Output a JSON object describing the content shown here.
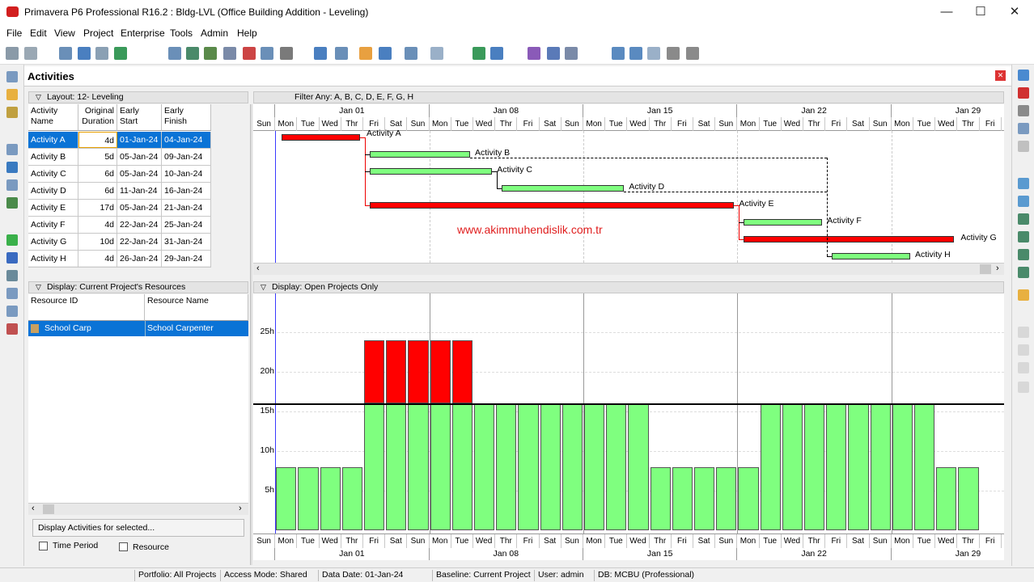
{
  "window": {
    "title": "Primavera P6 Professional R16.2 : Bldg-LVL (Office Building Addition - Leveling)",
    "min": "—",
    "max": "☐",
    "close": "✕"
  },
  "menu": [
    "File",
    "Edit",
    "View",
    "Project",
    "Enterprise",
    "Tools",
    "Admin",
    "Help"
  ],
  "panel": {
    "title": "Activities"
  },
  "layout_label": "Layout: 12- Leveling",
  "filter_label": "Filter Any: A, B, C, D, E, F, G, H",
  "columns": {
    "name": "Activity Name",
    "dur": "Original Duration",
    "start": "Early Start",
    "finish": "Early Finish"
  },
  "activities": [
    {
      "name": "Activity A",
      "dur": "4d",
      "start": "01-Jan-24",
      "finish": "04-Jan-24",
      "crit": true
    },
    {
      "name": "Activity B",
      "dur": "5d",
      "start": "05-Jan-24",
      "finish": "09-Jan-24",
      "crit": false
    },
    {
      "name": "Activity C",
      "dur": "6d",
      "start": "05-Jan-24",
      "finish": "10-Jan-24",
      "crit": false
    },
    {
      "name": "Activity D",
      "dur": "6d",
      "start": "11-Jan-24",
      "finish": "16-Jan-24",
      "crit": false
    },
    {
      "name": "Activity E",
      "dur": "17d",
      "start": "05-Jan-24",
      "finish": "21-Jan-24",
      "crit": true
    },
    {
      "name": "Activity F",
      "dur": "4d",
      "start": "22-Jan-24",
      "finish": "25-Jan-24",
      "crit": false
    },
    {
      "name": "Activity G",
      "dur": "10d",
      "start": "22-Jan-24",
      "finish": "31-Jan-24",
      "crit": true
    },
    {
      "name": "Activity H",
      "dur": "4d",
      "start": "26-Jan-24",
      "finish": "29-Jan-24",
      "crit": false
    }
  ],
  "weeks": [
    "Jan 01",
    "Jan 08",
    "Jan 15",
    "Jan 22",
    "Jan 29"
  ],
  "days": [
    "Sun",
    "Mon",
    "Tue",
    "Wed",
    "Thr",
    "Fri",
    "Sat"
  ],
  "watermark": "www.akimmuhendislik.com.tr",
  "resources_display": "Display: Current Project's Resources",
  "resource_cols": {
    "id": "Resource ID",
    "name": "Resource Name"
  },
  "resources": [
    {
      "id": "School Carp",
      "name": "School Carpenter"
    }
  ],
  "profile_display": "Display: Open Projects Only",
  "y_labels": [
    "25h",
    "20h",
    "15h",
    "10h",
    "5h"
  ],
  "histogram": {
    "unit": "h",
    "limit": 16,
    "values": [
      0,
      8,
      8,
      8,
      8,
      24,
      24,
      24,
      24,
      24,
      16,
      16,
      16,
      16,
      16,
      16,
      16,
      16,
      8,
      8,
      8,
      8,
      8,
      16,
      16,
      16,
      16,
      16,
      16,
      16,
      16,
      8,
      8,
      0,
      0
    ]
  },
  "display_selected": "Display Activities for selected...",
  "chk_time": "Time Period",
  "chk_res": "Resource",
  "status": [
    "Portfolio: All Projects",
    "Access Mode: Shared",
    "Data Date: 01-Jan-24",
    "Baseline: Current Project",
    "User: admin",
    "DB: MCBU (Professional)"
  ],
  "colors": {
    "critical": "#ff0000",
    "normal": "#7fff7f",
    "select": "#0a73d6"
  }
}
